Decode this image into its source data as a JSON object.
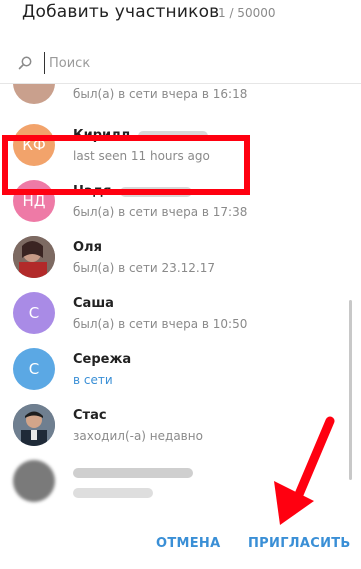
{
  "header": {
    "title": "Добавить участников",
    "count": "1 / 50000"
  },
  "search": {
    "placeholder": "Поиск"
  },
  "colors": {
    "accent": "#3a8fd6",
    "highlight": "#ff0010"
  },
  "contacts": [
    {
      "initials": "",
      "name": "",
      "status": "был(а) в сети вчера в 16:18",
      "online": false,
      "avatar_color": "#c9a08d"
    },
    {
      "initials": "КФ",
      "name": "Кирилл",
      "status": "last seen 11 hours ago",
      "online": false,
      "avatar_color": "#f2a36b"
    },
    {
      "initials": "НД",
      "name": "Надя",
      "status": "был(а) в сети вчера в 17:38",
      "online": false,
      "avatar_color": "#ee7aa6"
    },
    {
      "initials": "",
      "name": "Оля",
      "status": "был(а) в сети 23.12.17",
      "online": false,
      "avatar_color": "#5b3a3a"
    },
    {
      "initials": "С",
      "name": "Саша",
      "status": "был(а) в сети вчера в 10:50",
      "online": false,
      "avatar_color": "#a98be6"
    },
    {
      "initials": "С",
      "name": "Сережа",
      "status": "в сети",
      "online": true,
      "avatar_color": "#5ba8e4"
    },
    {
      "initials": "",
      "name": "Стас",
      "status": "заходил(-а) недавно",
      "online": false,
      "avatar_color": "#3b4a5e"
    },
    {
      "initials": "",
      "name": "",
      "status": "",
      "online": false,
      "avatar_color": "#7a7a7a"
    }
  ],
  "footer": {
    "cancel": "ОТМЕНА",
    "invite": "ПРИГЛАСИТЬ"
  }
}
